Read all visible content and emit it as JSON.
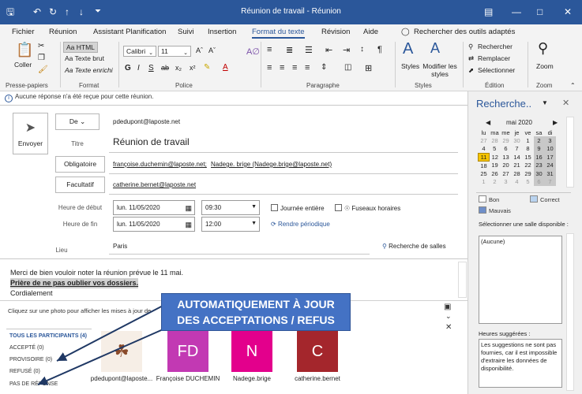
{
  "window": {
    "title": "Réunion de travail - Réunion"
  },
  "menu": [
    "Fichier",
    "Réunion",
    "Assistant Planification",
    "Suivi",
    "Insertion",
    "Format du texte",
    "Révision",
    "Aide"
  ],
  "menu_active": "Format du texte",
  "search_tools": "Rechercher des outils adaptés",
  "ribbon": {
    "coller": "Coller",
    "format_html": "Aa HTML",
    "format_plain": "Aa Texte brut",
    "format_rich": "Aa Texte enrichi",
    "font_name": "Calibri",
    "font_size": "11",
    "styles": "Styles",
    "modifier_styles": "Modifier les styles",
    "rechercher": "Rechercher",
    "remplacer": "Remplacer",
    "selectionner": "Sélectionner",
    "zoom": "Zoom",
    "groups": {
      "presse": "Presse-papiers",
      "format": "Format",
      "police": "Police",
      "paragraphe": "Paragraphe",
      "styles": "Styles",
      "edition": "Édition",
      "zoom": "Zoom"
    }
  },
  "info_bar": "Aucune réponse n'a été reçue pour cette réunion.",
  "form": {
    "envoyer": "Envoyer",
    "de_label": "De",
    "de_value": "pdedupont@laposte.net",
    "titre_label": "Titre",
    "titre_value": "Réunion de travail",
    "obligatoire_label": "Obligatoire",
    "obligatoire_value1": "françoise.duchemin@laposte.net;",
    "obligatoire_value2": "Nadege. brige (Nadege.brige@laposte.net)",
    "facultatif_label": "Facultatif",
    "facultatif_value": "catherine.bernet@laposte.net",
    "debut_label": "Heure de début",
    "debut_date": "lun. 11/05/2020",
    "debut_time": "09:30",
    "fin_label": "Heure de fin",
    "fin_date": "lun. 11/05/2020",
    "fin_time": "12:00",
    "journee": "Journée entière",
    "fuseaux": "Fuseaux horaires",
    "periodique": "Rendre périodique",
    "lieu_label": "Lieu",
    "lieu_value": "Paris",
    "recherche_salles": "Recherche de salles"
  },
  "body": {
    "line1": "Merci de bien vouloir noter la réunion prévue le 11 mai.",
    "line2": "Prière de ne pas oublier vos dossiers.",
    "line3": "Cordialement"
  },
  "tracking": {
    "photo_hint": "Cliquez sur une photo pour afficher les mises à jour de",
    "tous": "TOUS LES PARTICIPANTS (4)",
    "accepte": "ACCEPTÉ (0)",
    "provisoire": "PROVISOIRE (0)",
    "refuse": "REFUSÉ (0)",
    "pas_reponse": "PAS DE RÉPONSE",
    "people": [
      {
        "initials": "",
        "name": "pdedupont@laposte...",
        "color": "#ffffff"
      },
      {
        "initials": "FD",
        "name": "Françoise DUCHEMIN",
        "color": "#c239b3"
      },
      {
        "initials": "N",
        "name": "Nadege.brige",
        "color": "#e3008c"
      },
      {
        "initials": "C",
        "name": "catherine.bernet",
        "color": "#a4262c"
      }
    ]
  },
  "callout": {
    "line1": "AUTOMATIQUEMENT À JOUR",
    "line2": "DES ACCEPTATIONS / REFUS"
  },
  "pane": {
    "title": "Recherche..",
    "month": "mai 2020",
    "weekdays": [
      "lu",
      "ma",
      "me",
      "je",
      "ve",
      "sa",
      "di"
    ],
    "weeks": [
      [
        "27",
        "28",
        "29",
        "30",
        "1",
        "2",
        "3"
      ],
      [
        "4",
        "5",
        "6",
        "7",
        "8",
        "9",
        "10"
      ],
      [
        "11",
        "12",
        "13",
        "14",
        "15",
        "16",
        "17"
      ],
      [
        "18",
        "19",
        "20",
        "21",
        "22",
        "23",
        "24"
      ],
      [
        "25",
        "26",
        "27",
        "28",
        "29",
        "30",
        "31"
      ],
      [
        "1",
        "2",
        "3",
        "4",
        "5",
        "6",
        "7"
      ]
    ],
    "legend_bon": "Bon",
    "legend_correct": "Correct",
    "legend_mauvais": "Mauvais",
    "salle_label": "Sélectionner une salle disponible :",
    "salle_value": "(Aucune)",
    "heures_label": "Heures suggérées :",
    "heures_value": "Les suggestions ne sont pas fournies, car il est impossible d'extraire les données de disponibilité."
  }
}
